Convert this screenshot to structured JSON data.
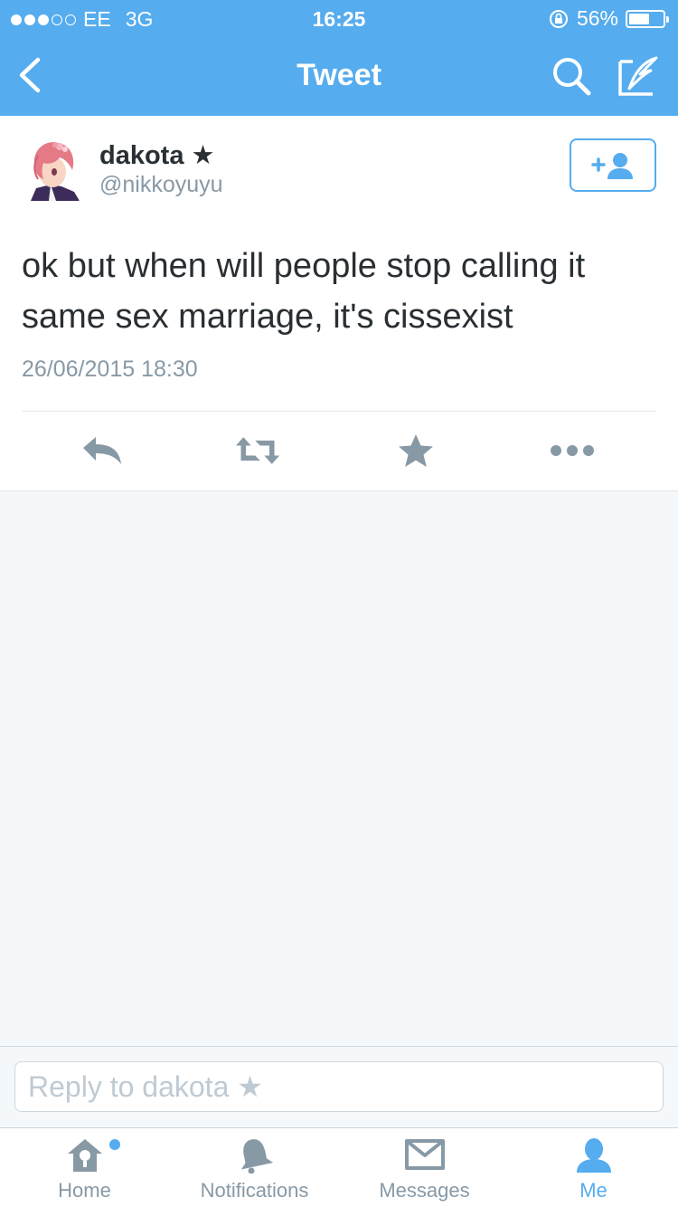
{
  "status_bar": {
    "carrier": "EE",
    "network": "3G",
    "time": "16:25",
    "battery": "56%",
    "battery_level": 0.56
  },
  "nav": {
    "title": "Tweet"
  },
  "tweet": {
    "display_name": "dakota ★",
    "handle": "@nikkoyuyu",
    "text": "ok but when will people stop calling it same sex marriage, it's cissexist",
    "timestamp": "26/06/2015 18:30"
  },
  "reply": {
    "placeholder": "Reply to dakota ★"
  },
  "tabs": [
    {
      "label": "Home",
      "icon": "home-icon"
    },
    {
      "label": "Notifications",
      "icon": "bell-icon"
    },
    {
      "label": "Messages",
      "icon": "envelope-icon"
    },
    {
      "label": "Me",
      "icon": "person-icon"
    }
  ],
  "colors": {
    "brand": "#55acee",
    "icon_gray": "#8899a6",
    "text": "#292f33",
    "background": "#f5f8fa"
  }
}
